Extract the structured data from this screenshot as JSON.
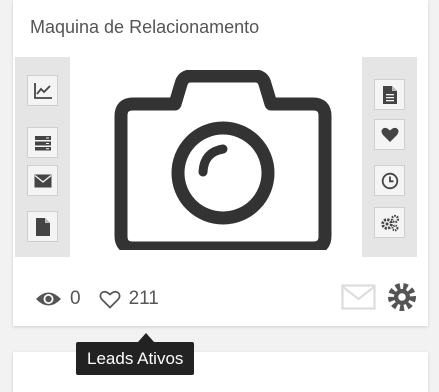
{
  "card": {
    "title": "Maquina de Relacionamento",
    "left_rail": [
      {
        "icon": "line-chart-icon",
        "name": "chart"
      },
      {
        "icon": "server-list-icon",
        "name": "list"
      },
      {
        "icon": "envelope-icon",
        "name": "email"
      },
      {
        "icon": "file-icon",
        "name": "file"
      }
    ],
    "right_rail": [
      {
        "icon": "file-text-icon",
        "name": "document"
      },
      {
        "icon": "heart-icon",
        "name": "favorite"
      },
      {
        "icon": "clock-icon",
        "name": "history"
      },
      {
        "icon": "cogs-icon",
        "name": "settings"
      }
    ],
    "image_icon": "camera-icon",
    "views": "0",
    "likes": "211",
    "colors": {
      "text": "#555555",
      "rail": "#e5e5e5",
      "icon": "#444444",
      "gear": "#555555",
      "mail_faded": "#dddddd"
    }
  },
  "tooltip": {
    "text": "Leads Ativos"
  }
}
